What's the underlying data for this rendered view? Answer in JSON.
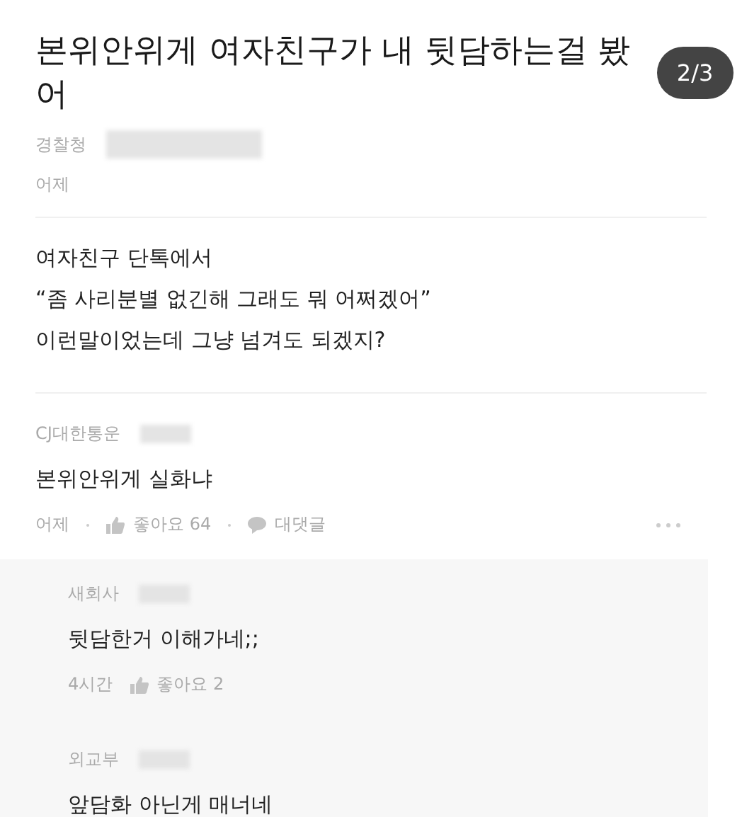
{
  "title": "본위안위게 여자친구가 내 뒷담하는걸 봤어",
  "page_indicator": "2/3",
  "post": {
    "company": "경찰청",
    "time": "어제",
    "body": [
      "여자친구 단톡에서",
      "“좀 사리분별 없긴해 그래도 뭐 어쩌겠어”",
      "이런말이었는데 그냥 넘겨도 되겠지?"
    ]
  },
  "comments": [
    {
      "company": "CJ대한통운",
      "text": "본위안위게 실화냐",
      "time": "어제",
      "likes": "좋아요 64",
      "reply_label": "대댓글",
      "replies": [
        {
          "company": "새회사",
          "text": "뒷담한거 이해가네;;",
          "time": "4시간",
          "likes": "좋아요 2"
        },
        {
          "company": "외교부",
          "text": "앞담화 아닌게 매너네"
        }
      ]
    }
  ]
}
